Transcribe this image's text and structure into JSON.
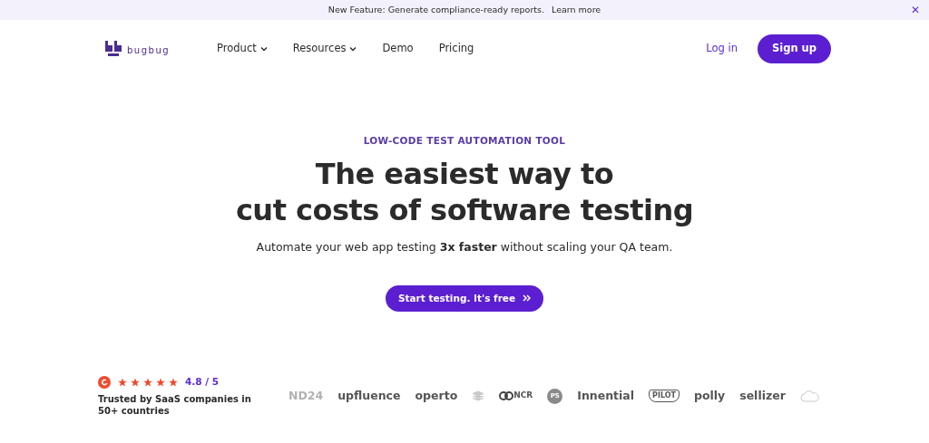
{
  "banner": {
    "text": "New Feature: Generate compliance-ready reports.",
    "link": "Learn more",
    "close": "✕"
  },
  "navbar": {
    "logo": "bugbug",
    "items": [
      {
        "label": "Product",
        "dropdown": true
      },
      {
        "label": "Resources",
        "dropdown": true
      },
      {
        "label": "Demo",
        "dropdown": false
      },
      {
        "label": "Pricing",
        "dropdown": false
      }
    ],
    "login": "Log in",
    "signup": "Sign up"
  },
  "hero": {
    "eyebrow": "LOW-CODE TEST AUTOMATION TOOL",
    "headline": [
      "The easiest way to",
      "cut costs of software testing"
    ],
    "subtitle": "Automate your web app testing **3x faster** without scaling your QA team.",
    "cta": "Start testing. It's free"
  },
  "trust": {
    "stars": 5,
    "rating": "4.8 / 5",
    "text": "Trusted by SaaS companies in 50+ countries"
  },
  "logos": [
    {
      "kind": "text",
      "text": "ND24",
      "faded": true
    },
    {
      "kind": "text",
      "text": "upfluence",
      "faded": false
    },
    {
      "kind": "text",
      "text": "operto",
      "faded": false
    },
    {
      "kind": "stack",
      "faded": true
    },
    {
      "kind": "rings",
      "text": "NCR",
      "faded": false
    },
    {
      "kind": "circle",
      "text": "PS",
      "faded": false
    },
    {
      "kind": "text",
      "text": "Innential",
      "faded": false
    },
    {
      "kind": "badge",
      "text": "PILOT",
      "faded": false
    },
    {
      "kind": "text",
      "text": "polly",
      "faded": false
    },
    {
      "kind": "text",
      "text": "sellizer",
      "faded": false
    },
    {
      "kind": "cloud",
      "faded": true
    }
  ]
}
